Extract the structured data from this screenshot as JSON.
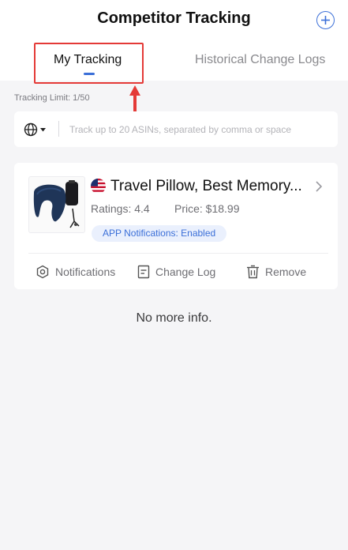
{
  "header": {
    "title": "Competitor Tracking",
    "add_icon": "plus-circle-icon"
  },
  "tabs": [
    {
      "label": "My Tracking",
      "active": true
    },
    {
      "label": "Historical Change Logs",
      "active": false
    }
  ],
  "annotation": {
    "highlight_color": "#e43a37"
  },
  "tracking_limit": "Tracking Limit: 1/50",
  "search": {
    "placeholder": "Track up to 20 ASINs, separated by comma or space",
    "value": "",
    "region_icon": "globe-icon"
  },
  "product": {
    "title": "Travel Pillow, Best Memory...",
    "ratings": "Ratings: 4.4",
    "price": "Price: $18.99",
    "notifications_badge": "APP Notifications: Enabled",
    "marketplace_flag": "us-flag-icon"
  },
  "actions": [
    {
      "label": "Notifications",
      "icon": "notifications-icon"
    },
    {
      "label": "Change Log",
      "icon": "change-log-icon"
    },
    {
      "label": "Remove",
      "icon": "trash-icon"
    }
  ],
  "footer_text": "No more info.",
  "colors": {
    "accent": "#3b6fd8",
    "badge_bg": "#eaf0fd",
    "page_bg": "#f5f5f7"
  }
}
